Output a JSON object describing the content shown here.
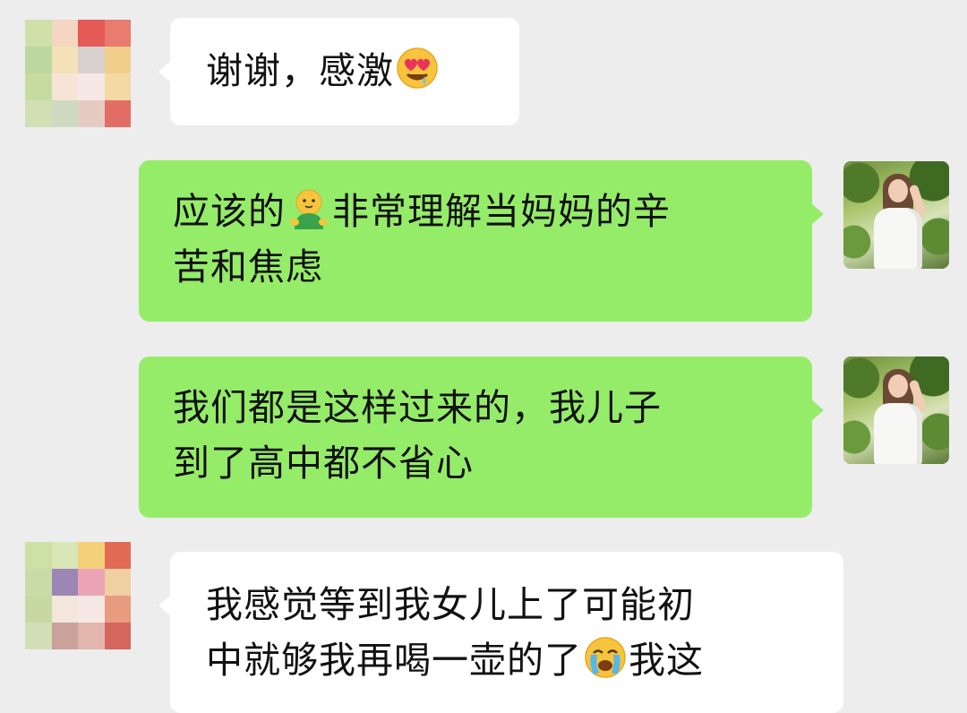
{
  "messages": [
    {
      "side": "left",
      "lines": [
        "谢谢，感激"
      ],
      "emoji": "heart-eyes-drool"
    },
    {
      "side": "right",
      "lines": [
        "应该的",
        "非常理解当妈妈的辛",
        "苦和焦虑"
      ],
      "emoji": "green-hug-figure"
    },
    {
      "side": "right",
      "lines": [
        "我们都是这样过来的，我儿子",
        "到了高中都不省心"
      ]
    },
    {
      "side": "left",
      "lines": [
        "我感觉等到我女儿上了可能初",
        "中就够我再喝一壶的了",
        "我这"
      ],
      "emoji": "loudly-crying-face"
    }
  ],
  "avatars": {
    "other_user": "pixelated-avatar",
    "self_user": "woman-in-white-dress-photo"
  },
  "colors": {
    "background": "#ededed",
    "incoming_bubble": "#ffffff",
    "outgoing_bubble": "#95ec69"
  }
}
